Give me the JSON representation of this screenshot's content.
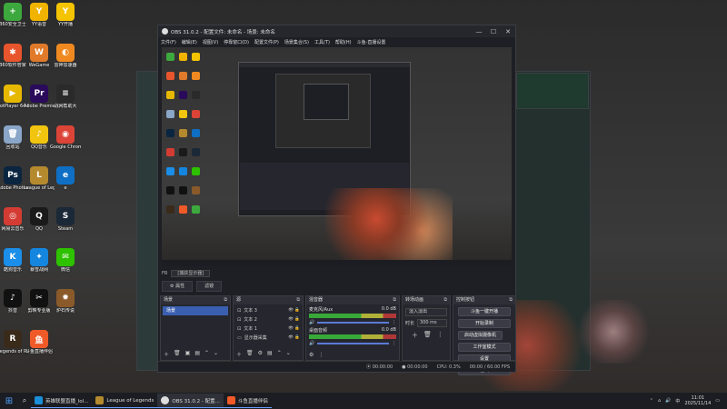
{
  "desktop": {
    "icons": [
      {
        "label": "360安全卫士",
        "color": "#3da83d",
        "glyph": "+"
      },
      {
        "label": "YY语音",
        "color": "#f0b400",
        "glyph": "Y"
      },
      {
        "label": "YY开播",
        "color": "#f5c400",
        "glyph": "Y"
      },
      {
        "label": "360软件管家",
        "color": "#e8552d",
        "glyph": "✱"
      },
      {
        "label": "WeGame",
        "color": "#e07a2a",
        "glyph": "W"
      },
      {
        "label": "雷神加速器",
        "color": "#f08a20",
        "glyph": "◐"
      },
      {
        "label": "PotPlayer 64 bit",
        "color": "#e6b800",
        "glyph": "▶"
      },
      {
        "label": "Adobe Premie...",
        "color": "#2a0a5a",
        "glyph": "Pr"
      },
      {
        "label": "战网帮助大",
        "color": "#2a2a2a",
        "glyph": "≡"
      },
      {
        "label": "回收站",
        "color": "#8aa6c8",
        "glyph": "🗑"
      },
      {
        "label": "QQ音乐",
        "color": "#f1c40f",
        "glyph": "♪"
      },
      {
        "label": "Google Chrome",
        "color": "#db4437",
        "glyph": "◉"
      },
      {
        "label": "Adobe Photosh...",
        "color": "#0a2540",
        "glyph": "Ps"
      },
      {
        "label": "League of Legends",
        "color": "#b58a2e",
        "glyph": "L"
      },
      {
        "label": "e",
        "color": "#0e6fc4",
        "glyph": "e"
      },
      {
        "label": "网易云音乐",
        "color": "#d43c33",
        "glyph": "◎"
      },
      {
        "label": "QQ",
        "color": "#1a1a1a",
        "glyph": "Q"
      },
      {
        "label": "Steam",
        "color": "#1b2838",
        "glyph": "S"
      },
      {
        "label": "酷狗音乐",
        "color": "#1a8ee8",
        "glyph": "K"
      },
      {
        "label": "暴雪战网",
        "color": "#1486e0",
        "glyph": "✦"
      },
      {
        "label": "微信",
        "color": "#2dc100",
        "glyph": "✉"
      },
      {
        "label": "抖音",
        "color": "#111111",
        "glyph": "♪"
      },
      {
        "label": "剪映专业版",
        "color": "#111111",
        "glyph": "✂"
      },
      {
        "label": "炉石传说",
        "color": "#8a5a2a",
        "glyph": "✹"
      },
      {
        "label": "Legends of Runeterra",
        "color": "#3a2a1a",
        "glyph": "R"
      },
      {
        "label": "斗鱼直播伴侣",
        "color": "#f05a28",
        "glyph": "鱼"
      }
    ]
  },
  "obs": {
    "title": "OBS 31.0.2 - 配置文件: 未命名 - 场景: 未命名",
    "menu": [
      "文件(F)",
      "编辑(E)",
      "视图(V)",
      "停靠窗口(D)",
      "配置文件(P)",
      "场景集合(S)",
      "工具(T)",
      "帮助(H)",
      "斗鱼-直播设置"
    ],
    "source_bar": {
      "label": "FR",
      "value": "[捕获显示器]"
    },
    "tools": {
      "properties": "⚙ 属性",
      "filters": "滤镜"
    },
    "scenes": {
      "title": "场景",
      "items": [
        "场景"
      ]
    },
    "sources": {
      "title": "源",
      "items": [
        "文本 3",
        "文本 2",
        "文本 1",
        "显示器采集"
      ]
    },
    "audio": {
      "title": "混音器",
      "tracks": [
        {
          "name": "麦克风/Aux",
          "db": "0.0 dB"
        },
        {
          "name": "桌面音频",
          "db": "0.0 dB"
        }
      ]
    },
    "transition": {
      "title": "转场动画",
      "type": "淡入淡出",
      "duration_label": "时长",
      "duration": "300 ms"
    },
    "controls": {
      "title": "控制按钮",
      "buttons": [
        "斗鱼一键开播",
        "开始录制",
        "启动虚拟摄像机",
        "工作室模式",
        "设置",
        "退出"
      ]
    },
    "status": {
      "rec": "00:00:00",
      "stream": "00:00:00",
      "cpu": "CPU: 0.3%",
      "fps": "00:00 / 60.00 FPS"
    }
  },
  "taskbar": {
    "items": [
      "英雄联盟直播_lol...",
      "League of Legends",
      "OBS 31.0.2 - 配置...",
      "斗鱼直播伴侣"
    ],
    "time": "11:01",
    "date": "2025/11/14",
    "lang": "中"
  },
  "colors": {
    "accent": "#3a5fb0",
    "meter_green": "#3bbf3b",
    "meter_yellow": "#c9c93a",
    "meter_red": "#c93a3a"
  }
}
